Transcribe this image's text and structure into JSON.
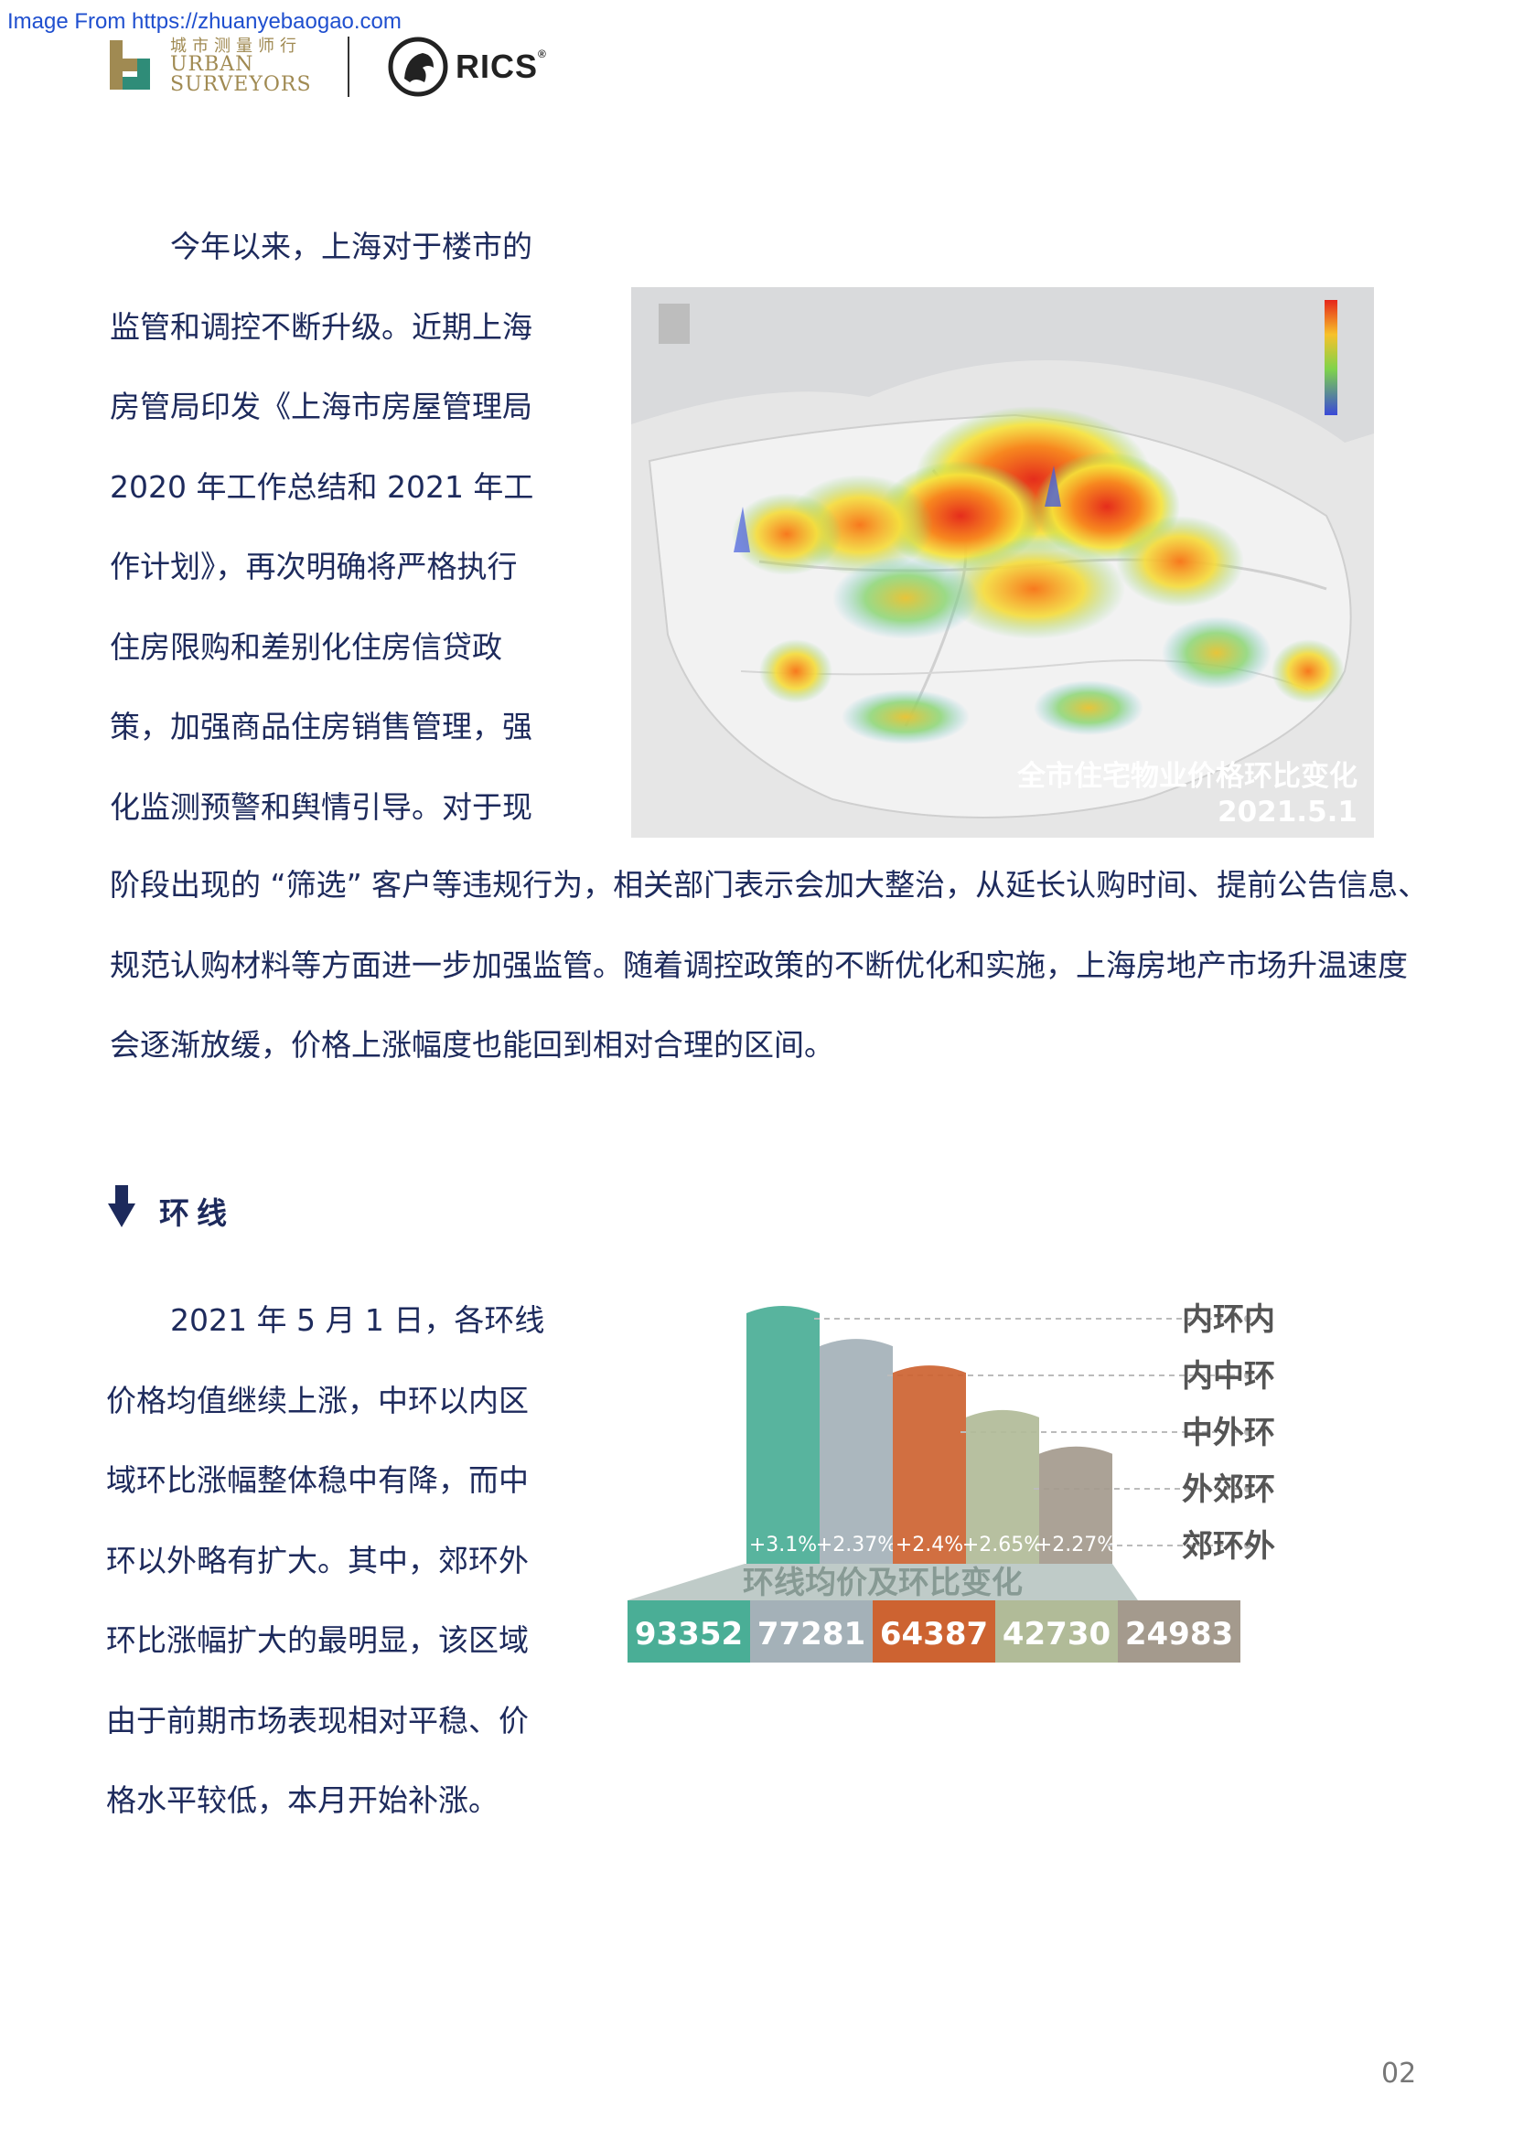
{
  "header": {
    "source_text": "Image From https://zhuanyebaogao.com",
    "logo_cn": "城市测量师行",
    "logo_en_line1": "URBAN",
    "logo_en_line2": "SURVEYORS",
    "partner_logo": "RICS",
    "partner_reg": "®"
  },
  "paragraph1": {
    "lines": [
      "今年以来，上海对于楼市的",
      "监管和调控不断升级。近期上海",
      "房管局印发《上海市房屋管理局",
      "2020 年工作总结和 2021 年工",
      "作计划》，再次明确将严格执行",
      "住房限购和差别化住房信贷政",
      "策，加强商品住房销售管理，强",
      "化监测预警和舆情引导。对于现"
    ],
    "full_lines": [
      "阶段出现的 “筛选” 客户等违规行为，相关部门表示会加大整治，从延长认购时间、提前公告信息、",
      "规范认购材料等方面进一步加强监管。随着调控政策的不断优化和实施，上海房地产市场升温速度",
      "会逐渐放缓，价格上涨幅度也能回到相对合理的区间。"
    ]
  },
  "map": {
    "title": "全市住宅物业价格环比变化",
    "date": "2021.5.1"
  },
  "section": {
    "title": "环线"
  },
  "paragraph2": {
    "lines": [
      "2021 年 5 月 1 日，各环线",
      "价格均值继续上涨，中环以内区",
      "域环比涨幅整体稳中有降，而中",
      "环以外略有扩大。其中，郊环外",
      "环比涨幅扩大的最明显，该区域",
      "由于前期市场表现相对平稳、价",
      "格水平较低，本月开始补涨。"
    ]
  },
  "chart_data": {
    "type": "bar",
    "title": "环线均价及环比变化",
    "categories": [
      "内环内",
      "内中环",
      "中外环",
      "外郊环",
      "郊环外"
    ],
    "prices": [
      93352,
      77281,
      64387,
      42730,
      24983
    ],
    "mom_change_pct": [
      3.1,
      2.37,
      2.4,
      2.65,
      2.27
    ],
    "mom_labels": [
      "+3.1%",
      "+2.37%",
      "+2.4%",
      "+2.65%",
      "+2.27%"
    ],
    "colors": [
      "#4aae96",
      "#a4b1b8",
      "#cd6331",
      "#b1bb98",
      "#a49a8d"
    ],
    "legend_placement": "right"
  },
  "footer": {
    "page_number": "02"
  }
}
